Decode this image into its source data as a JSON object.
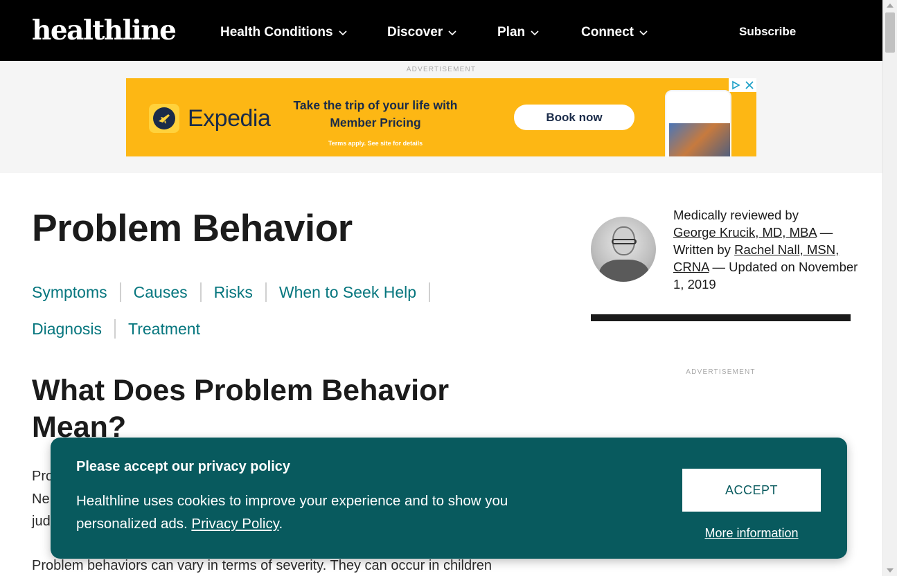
{
  "nav": {
    "logo": "healthline",
    "items": [
      {
        "label": "Health Conditions"
      },
      {
        "label": "Discover"
      },
      {
        "label": "Plan"
      },
      {
        "label": "Connect"
      }
    ],
    "subscribe": "Subscribe",
    "colors": {
      "background": "#000000",
      "text": "#ffffff"
    }
  },
  "ads": {
    "label": "ADVERTISEMENT",
    "banner": {
      "brand": "Expedia",
      "tagline": "Take the trip of your life with Member Pricing",
      "terms": "Terms apply. See site for details",
      "cta": "Book now",
      "background": "#fdb714"
    },
    "sidebar_label": "ADVERTISEMENT"
  },
  "article": {
    "title": "Problem Behavior",
    "toc": [
      "Symptoms",
      "Causes",
      "Risks",
      "When to Seek Help",
      "Diagnosis",
      "Treatment"
    ],
    "section_heading": "What Does Problem Behavior Mean?",
    "fragments": [
      "Pro",
      "Ne",
      "jud"
    ],
    "paragraph2_visible": "Problem behaviors can vary in terms of severity. They can occur in children",
    "accent_color": "#06767e"
  },
  "review": {
    "prefix": "Medically reviewed by",
    "reviewer": "George Krucik, MD, MBA",
    "mid": "— Written by",
    "writer": "Rachel Nall, MSN, CRNA",
    "updated": "— Updated on November 1, 2019"
  },
  "cookie": {
    "title": "Please accept our privacy policy",
    "body": "Healthline uses cookies to improve your experience and to show you personalized ads.",
    "policy_link": "Privacy Policy",
    "body_end": ".",
    "accept": "ACCEPT",
    "more": "More information",
    "background": "#085a5e"
  }
}
